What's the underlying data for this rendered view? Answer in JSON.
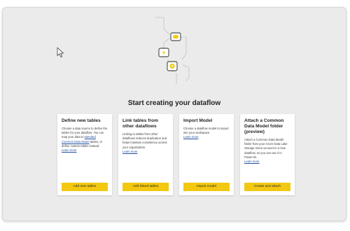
{
  "heading": "Start creating your dataflow",
  "accent_color": "#f2c811",
  "cards": [
    {
      "title": "Define new tables",
      "desc_pre": "Choose a data source to define the tables for your dataflow. You can map your data to ",
      "desc_link": "standard Common Data Model",
      "desc_post": " tables, or define custom tables instead.",
      "learn_more": "Learn more",
      "button": "Add new tables"
    },
    {
      "title": "Link tables from other dataflows",
      "desc": "Linking to tables from other dataflows reduces duplication and helps maintain consistency across your organization.",
      "learn_more": "Learn more",
      "button": "Add linked tables"
    },
    {
      "title": "Import Model",
      "desc": "Choose a dataflow model to import into your workspace.",
      "learn_more": "Learn more",
      "button": "Import model"
    },
    {
      "title": "Attach a Common Data Model folder (preview)",
      "desc": "Attach a Common Data Model folder from your Azure Data Lake Storage Gen2 account to a new dataflow, so you can use it in Power BI.",
      "learn_more": "Learn more",
      "button": "Create and attach"
    }
  ],
  "icons": [
    "mouse-pointer-icon",
    "dataflow-illustration",
    "cloud-icon",
    "lightning-icon",
    "gear-icon"
  ]
}
